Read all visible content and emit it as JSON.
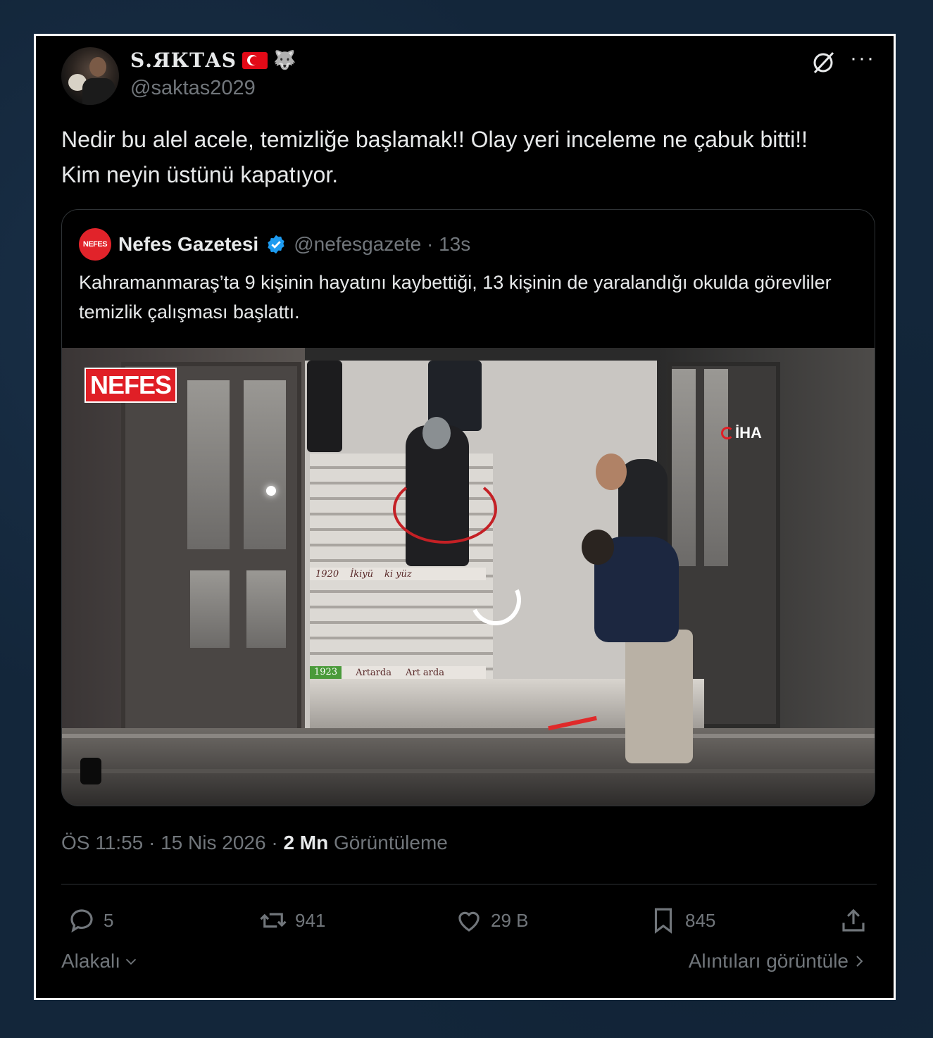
{
  "author": {
    "display_name": "ᏕᏗ ᏦᏖᏗᏕ",
    "display_name_rendered": "Ѕ.ЯКТАЅ",
    "emblem": "🐺",
    "handle": "@saktas2029"
  },
  "tweet": {
    "text": "Nedir bu alel acele, temizliğe başlamak!! Olay yeri inceleme ne çabuk bitti!! Kim neyin üstünü kapatıyor."
  },
  "quoted": {
    "logo_text": "NEFES",
    "name": "Nefes Gazetesi",
    "handle_time": "@nefesgazete · 13s",
    "text": "Kahramanmaraş’ta 9 kişinin hayatını kaybettiği, 13 kişinin de yaralandığı okulda görevliler temizlik çalışması başlattı.",
    "media": {
      "brand_logo": "NEFES",
      "agency_logo": "İHA",
      "sign_top": [
        "1920",
        "İkiyü",
        "ki yüz"
      ],
      "sign_bottom": [
        "1923",
        "Artarda",
        "Art arda"
      ]
    }
  },
  "meta": {
    "time": "ÖS 11:55 · 15 Nis 2026 · ",
    "views_count": "2 Mn",
    "views_label": " Görüntüleme"
  },
  "actions": {
    "replies": "5",
    "reposts": "941",
    "likes": "29 B",
    "bookmarks": "845"
  },
  "footer": {
    "related": "Alakalı",
    "view_quotes": "Alıntıları görüntüle"
  },
  "colors": {
    "background": "#000000",
    "text": "#e7e9ea",
    "muted": "#71767b",
    "border": "#2f3336",
    "verified": "#1d9bf0",
    "nefes_red": "#e01f26"
  },
  "icons": [
    "grok-icon",
    "more-icon",
    "verified-icon",
    "reply-icon",
    "repost-icon",
    "like-icon",
    "bookmark-icon",
    "share-icon",
    "chevron-down-icon",
    "chevron-right-icon"
  ]
}
